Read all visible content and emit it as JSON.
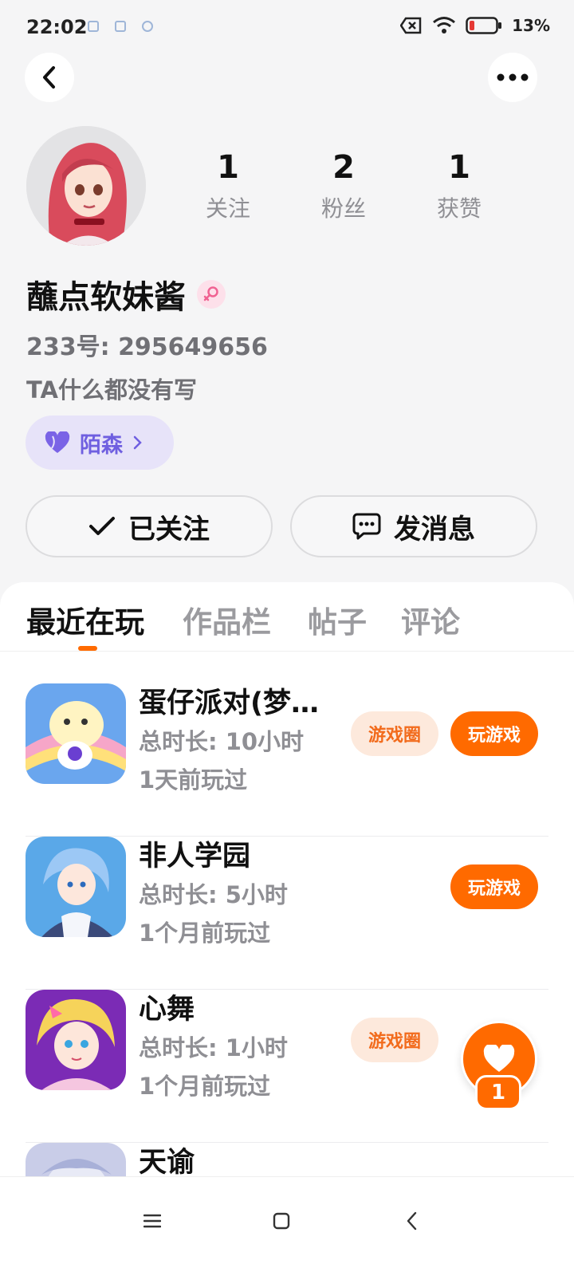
{
  "status_bar": {
    "time": "22:02",
    "battery": "13%"
  },
  "profile": {
    "username": "蘸点软妹酱",
    "id_text": "233号: 295649656",
    "bio": "TA什么都没有写",
    "tag": "陌森"
  },
  "stats": [
    {
      "value": "1",
      "label": "关注"
    },
    {
      "value": "2",
      "label": "粉丝"
    },
    {
      "value": "1",
      "label": "获赞"
    }
  ],
  "actions": {
    "follow_label": "已关注",
    "message_label": "发消息"
  },
  "tabs": [
    {
      "label": "最近在玩"
    },
    {
      "label": "作品栏"
    },
    {
      "label": "帖子"
    },
    {
      "label": "评论"
    }
  ],
  "games": [
    {
      "title": "蛋仔派对(梦…",
      "duration": "总时长: 10小时",
      "last_played": "1天前玩过",
      "circle": "游戏圈",
      "play": "玩游戏"
    },
    {
      "title": "非人学园",
      "duration": "总时长: 5小时",
      "last_played": "1个月前玩过",
      "circle": "",
      "play": "玩游戏"
    },
    {
      "title": "心舞",
      "duration": "总时长: 1小时",
      "last_played": "1个月前玩过",
      "circle": "游戏圈",
      "play": ""
    },
    {
      "title": "天谕",
      "duration": "",
      "last_played": "",
      "circle": "",
      "play": ""
    }
  ],
  "float_like": {
    "count": "1"
  },
  "colors": {
    "accent": "#ff6a00",
    "tag": "#6f5fe0",
    "muted": "#8f8f94"
  }
}
